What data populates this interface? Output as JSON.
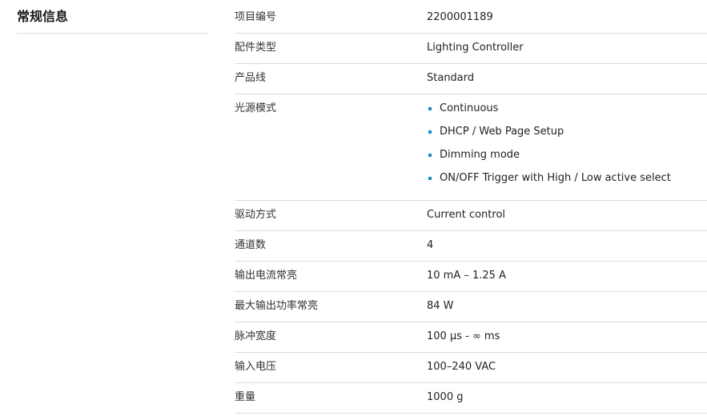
{
  "section": {
    "title": "常规信息"
  },
  "specs": {
    "item_number": {
      "label": "项目编号",
      "value": "2200001189"
    },
    "accessory_type": {
      "label": "配件类型",
      "value": "Lighting Controller"
    },
    "product_line": {
      "label": "产品线",
      "value": "Standard"
    },
    "light_source_mode": {
      "label": "光源模式",
      "values": [
        "Continuous",
        "DHCP / Web Page Setup",
        "Dimming mode",
        "ON/OFF Trigger with High / Low active select"
      ]
    },
    "drive_mode": {
      "label": "驱动方式",
      "value": "Current control"
    },
    "channels": {
      "label": "通道数",
      "value": "4"
    },
    "output_current": {
      "label": "输出电流常亮",
      "value": "10 mA – 1.25 A"
    },
    "max_output_power": {
      "label": "最大输出功率常亮",
      "value": "84 W"
    },
    "pulse_width": {
      "label": "脉冲宽度",
      "value": "100 µs - ∞ ms"
    },
    "input_voltage": {
      "label": "输入电压",
      "value": "100–240 VAC"
    },
    "weight": {
      "label": "重量",
      "value": "1000 g"
    }
  },
  "colors": {
    "bullet": "#1a8ccc",
    "divider": "#dcdcdc"
  }
}
